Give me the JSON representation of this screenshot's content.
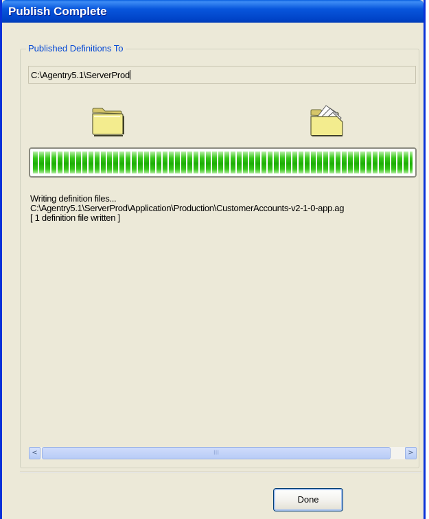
{
  "window": {
    "title": "Publish Complete"
  },
  "group": {
    "legend": "Published Definitions To",
    "path_value": "C:\\Agentry5.1\\ServerProd"
  },
  "icons": {
    "source": "closed-folder-icon",
    "destination": "open-folder-with-documents-icon"
  },
  "progress": {
    "percent": 100,
    "color": "#1dae05"
  },
  "log": {
    "lines": [
      "Writing definition files...",
      "C:\\Agentry5.1\\ServerProd\\Application\\Production\\CustomerAccounts-v2-1-0-app.ag",
      "[ 1 definition file written ]"
    ]
  },
  "scrollbar": {
    "left_arrow": "<",
    "right_arrow": ">",
    "thumb_grip": "III"
  },
  "buttons": {
    "done": "Done"
  },
  "colors": {
    "titlebar": "#0054e3",
    "dialog_background": "#ece9d8",
    "legend_text": "#0046d5"
  }
}
